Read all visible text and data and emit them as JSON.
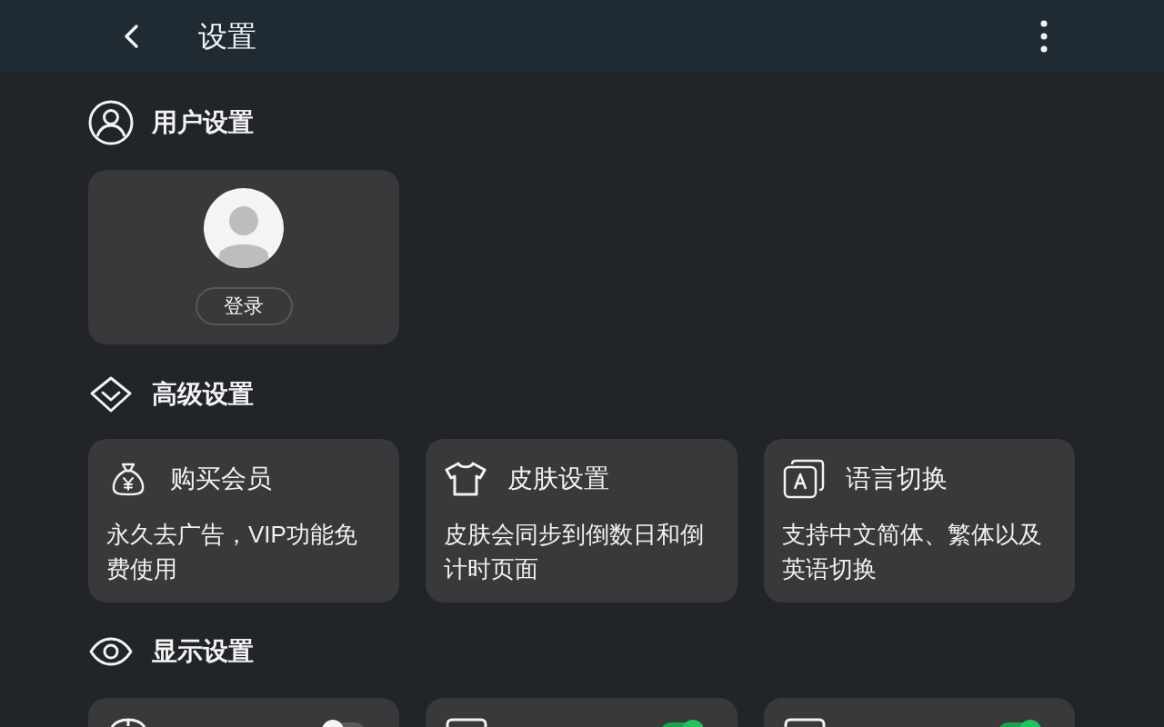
{
  "top_bar": {
    "title": "设置"
  },
  "user_settings": {
    "title": "用户设置",
    "login_button": "登录"
  },
  "advanced_settings": {
    "title": "高级设置",
    "cards": [
      {
        "title": "购买会员",
        "description": "永久去广告，VIP功能免费使用"
      },
      {
        "title": "皮肤设置",
        "description": "皮肤会同步到倒数日和倒计时页面"
      },
      {
        "title": "语言切换",
        "description": "支持中文简体、繁体以及英语切换"
      }
    ]
  },
  "display_settings": {
    "title": "显示设置",
    "cards": [
      {
        "on": false
      },
      {
        "on": true
      },
      {
        "on": true
      }
    ]
  }
}
